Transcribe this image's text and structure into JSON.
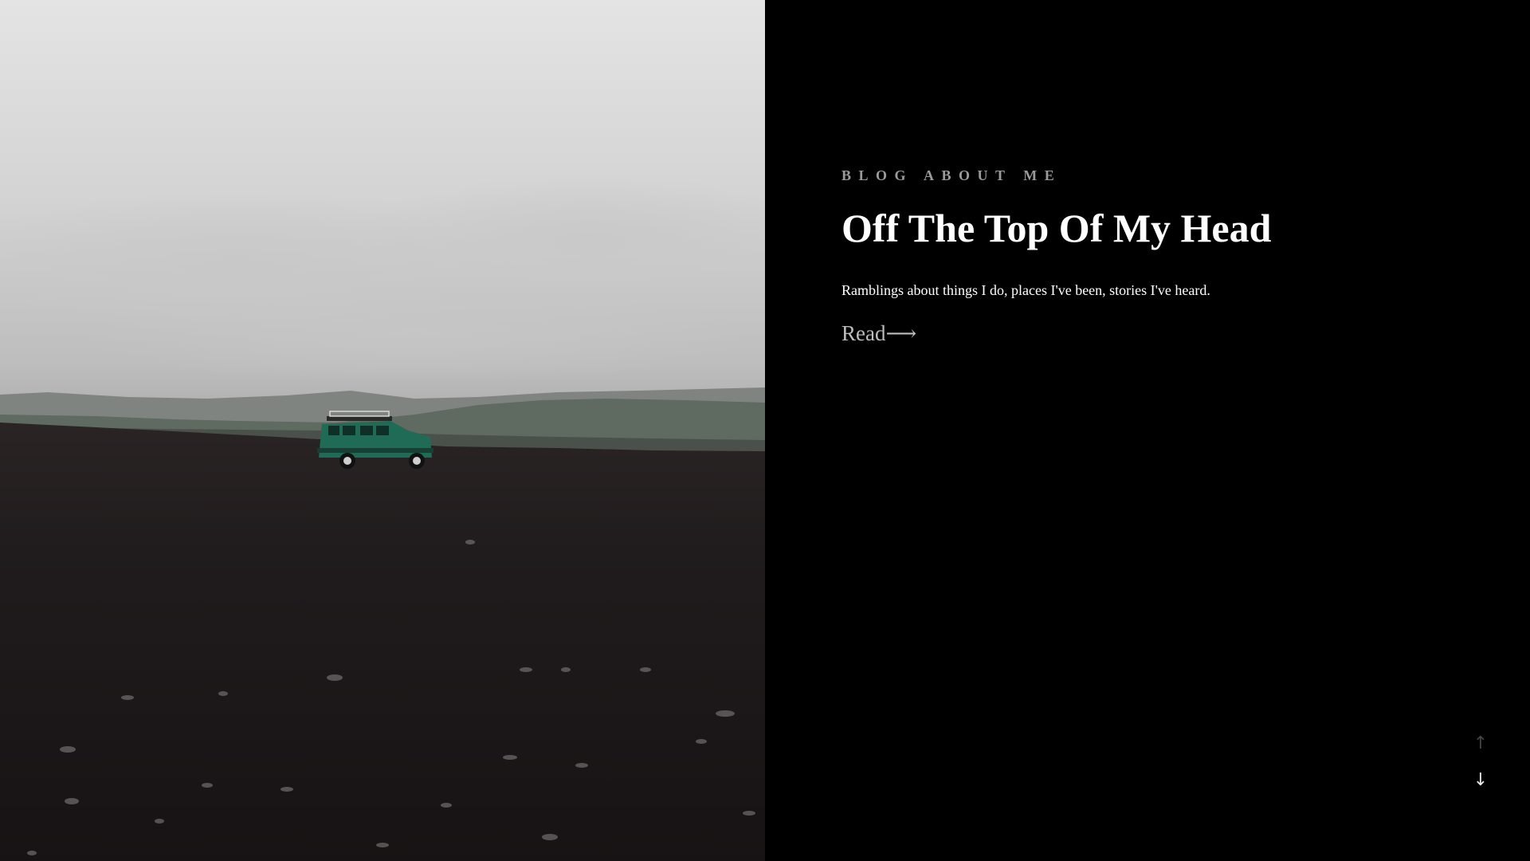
{
  "hero": {
    "kicker": "BLOG ABOUT ME",
    "title": "Off The Top Of My Head",
    "tagline": "Ramblings about things I do, places I've been, stories I've heard.",
    "read_label": "Read⟶"
  },
  "scroll_nav": {
    "up_glyph": "↑",
    "down_glyph": "↓"
  },
  "photo": {
    "subject_icon": "landscape-with-green-4x4-vehicle"
  },
  "colors": {
    "panel_background": "#000000",
    "kicker": "#9a9a9a",
    "title": "#ffffff",
    "read_link": "#bdbdbd",
    "vehicle": "#1f6b55"
  }
}
